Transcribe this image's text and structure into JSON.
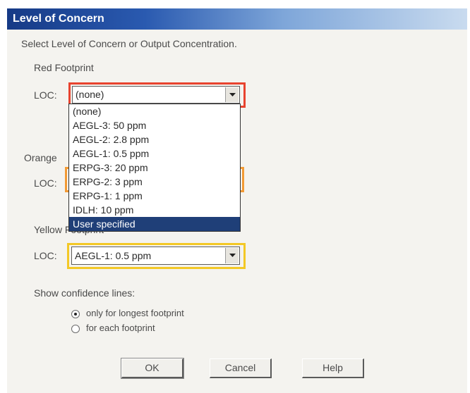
{
  "dialog": {
    "title": "Level of Concern",
    "instruction": "Select Level of Concern or Output Concentration."
  },
  "red": {
    "label": "Red Footprint",
    "loc_label": "LOC:",
    "value": "(none)",
    "frame_color": "#e8432f"
  },
  "orange": {
    "label_visible": "Orange",
    "loc_label": "LOC:",
    "frame_color": "#f29a35"
  },
  "yellow": {
    "label": "Yellow Footprint",
    "loc_label": "LOC:",
    "value": "AEGL-1: 0.5 ppm",
    "frame_color": "#f3c826"
  },
  "dropdown": {
    "items": [
      "(none)",
      "AEGL-3: 50 ppm",
      "AEGL-2: 2.8 ppm",
      "AEGL-1: 0.5 ppm",
      "ERPG-3: 20 ppm",
      "ERPG-2: 3 ppm",
      "ERPG-1: 1 ppm",
      "IDLH: 10 ppm",
      "User specified"
    ],
    "highlighted": "User specified"
  },
  "confidence": {
    "label": "Show confidence lines:",
    "options": [
      "only for longest footprint",
      "for each footprint"
    ],
    "selected": "only for longest footprint"
  },
  "buttons": {
    "ok": "OK",
    "cancel": "Cancel",
    "help": "Help"
  },
  "icons": {
    "combo_arrow": "chevron-down-icon",
    "radio": "radio-button"
  }
}
